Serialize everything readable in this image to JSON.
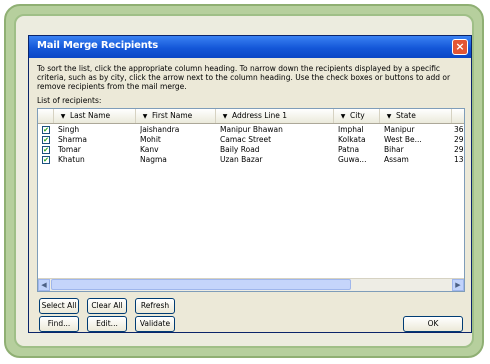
{
  "dialog": {
    "title": "Mail Merge Recipients",
    "close_label": "×",
    "instructions": "To sort the list, click the appropriate column heading. To narrow down the recipients displayed by a specific criteria, such as by city, click the arrow next to the column heading. Use the check boxes or buttons to add or remove recipients from the mail merge.",
    "list_label": "List of recipients:"
  },
  "columns": [
    {
      "label": "Last Name",
      "arrow": "▼"
    },
    {
      "label": "First Name",
      "arrow": "▼"
    },
    {
      "label": "Address Line 1",
      "arrow": "▼"
    },
    {
      "label": "City",
      "arrow": "▼"
    },
    {
      "label": "State",
      "arrow": "▼"
    },
    {
      "label": "",
      "arrow": ""
    }
  ],
  "rows": [
    {
      "checked": "✔",
      "cells": [
        "Singh",
        "Jaishandra",
        "Manipur Bhawan",
        "Imphal",
        "Manipur",
        "36"
      ]
    },
    {
      "checked": "✔",
      "cells": [
        "Sharma",
        "Mohit",
        "Camac Street",
        "Kolkata",
        "West Be...",
        "29"
      ]
    },
    {
      "checked": "✔",
      "cells": [
        "Tomar",
        "Kanv",
        "Baily Road",
        "Patna",
        "Bihar",
        "29"
      ]
    },
    {
      "checked": "✔",
      "cells": [
        "Khatun",
        "Nagma",
        "Uzan Bazar",
        "Guwa...",
        "Assam",
        "13"
      ]
    }
  ],
  "scrollbar": {
    "left_arrow": "◀",
    "right_arrow": "▶"
  },
  "buttons": {
    "select_all": "Select All",
    "clear_all": "Clear All",
    "refresh": "Refresh",
    "find": "Find...",
    "edit": "Edit...",
    "validate": "Validate",
    "ok": "OK"
  }
}
